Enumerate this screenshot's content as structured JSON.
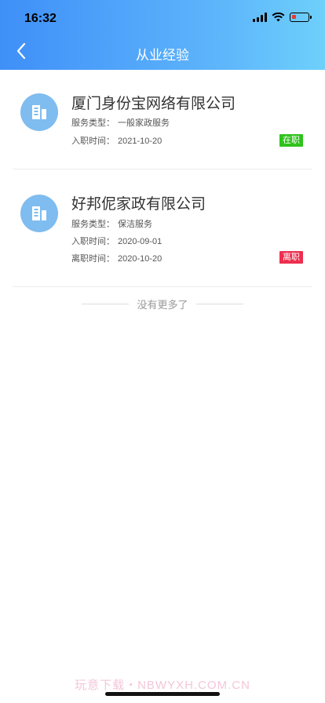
{
  "status_bar": {
    "time": "16:32"
  },
  "header": {
    "title": "从业经验"
  },
  "colors": {
    "header_start": "#3f8ff8",
    "header_end": "#6ed0fb",
    "status_active": "#2fc21b",
    "status_left": "#ee2e4f"
  },
  "experiences": [
    {
      "company": "厦门身份宝网络有限公司",
      "service_label": "服务类型：",
      "service_value": "一般家政服务",
      "start_label": "入职时间：",
      "start_value": "2021-10-20",
      "status": "在职",
      "icon": "building-icon"
    },
    {
      "company": "好邦伲家政有限公司",
      "service_label": "服务类型：",
      "service_value": "保洁服务",
      "start_label": "入职时间：",
      "start_value": "2020-09-01",
      "end_label": "离职时间：",
      "end_value": "2020-10-20",
      "status": "离职",
      "icon": "building-icon"
    }
  ],
  "footer": {
    "no_more": "没有更多了"
  },
  "watermark": "玩意下载・NBWYXH.COM.CN"
}
